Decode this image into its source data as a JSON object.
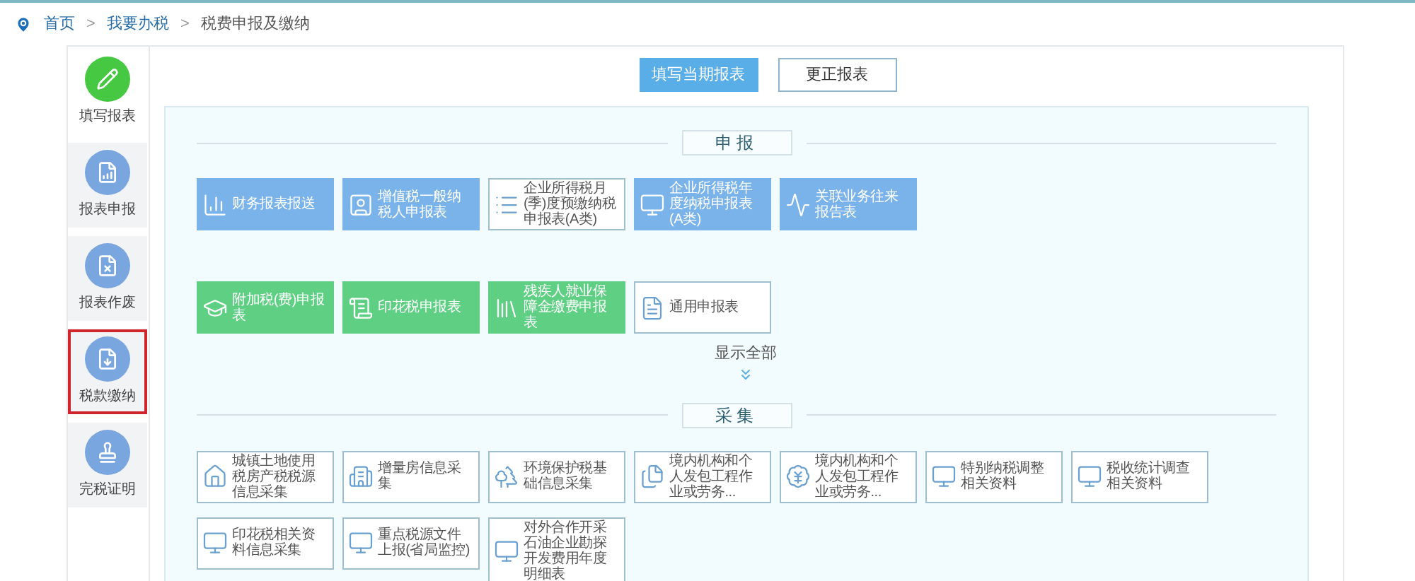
{
  "breadcrumb": [
    "首页",
    "我要办税",
    "税费申报及缴纳"
  ],
  "breadcrumb_separator": ">",
  "sidebar": {
    "items": [
      {
        "label": "填写报表",
        "selected": true,
        "marked": false
      },
      {
        "label": "报表申报",
        "selected": false,
        "marked": false
      },
      {
        "label": "报表作废",
        "selected": false,
        "marked": false
      },
      {
        "label": "税款缴纳",
        "selected": false,
        "marked": true
      },
      {
        "label": "完税证明",
        "selected": false,
        "marked": false
      }
    ]
  },
  "top_buttons": [
    {
      "label": "填写当期报表",
      "selected": true
    },
    {
      "label": "更正报表",
      "selected": false
    }
  ],
  "sections": [
    {
      "title": "申报",
      "rows": [
        [
          {
            "label": "财务报表报送",
            "kind": "blue"
          },
          {
            "label": "增值税一般纳税人申报表",
            "kind": "blue"
          },
          {
            "label": "企业所得税月(季)度预缴纳税申报表(A类)",
            "kind": "outline"
          },
          {
            "label": "企业所得税年度纳税申报表(A类)",
            "kind": "blue"
          },
          {
            "label": "关联业务往来报告表",
            "kind": "blue"
          }
        ],
        [
          {
            "label": "附加税(费)申报表",
            "kind": "green"
          },
          {
            "label": "印花税申报表",
            "kind": "green"
          },
          {
            "label": "残疾人就业保障金缴费申报表",
            "kind": "green"
          },
          {
            "label": "通用申报表",
            "kind": "outline"
          }
        ]
      ],
      "show_all": "显示全部"
    },
    {
      "title": "采集",
      "rows": [
        [
          {
            "label": "城镇土地使用税房产税税源信息采集",
            "kind": "outline"
          },
          {
            "label": "增量房信息采集",
            "kind": "outline"
          },
          {
            "label": "环境保护税基础信息采集",
            "kind": "outline"
          },
          {
            "label": "境内机构和个人发包工程作业或劳务...",
            "kind": "outline"
          },
          {
            "label": "境内机构和个人发包工程作业或劳务...",
            "kind": "outline"
          },
          {
            "label": "特别纳税调整相关资料",
            "kind": "outline"
          },
          {
            "label": "税收统计调查相关资料",
            "kind": "outline"
          }
        ],
        [
          {
            "label": "印花税相关资料信息采集",
            "kind": "outline"
          },
          {
            "label": "重点税源文件上报(省局监控)",
            "kind": "outline"
          },
          {
            "label": "对外合作开采石油企业勘探开发费用年度明细表",
            "kind": "outline"
          }
        ]
      ]
    }
  ]
}
